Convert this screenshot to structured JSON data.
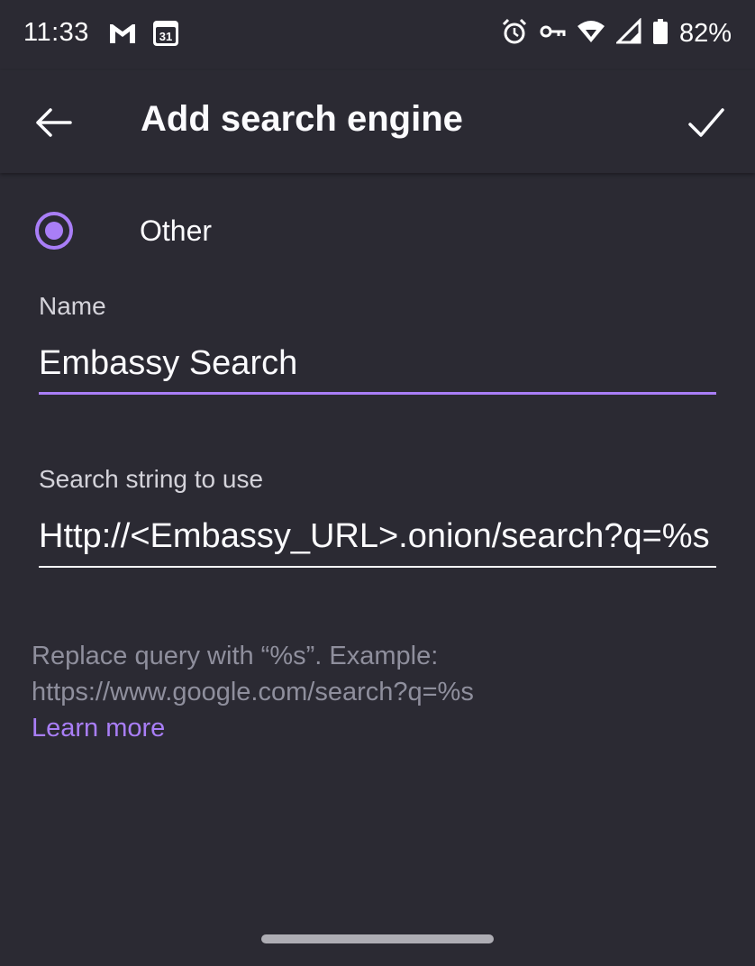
{
  "status_bar": {
    "time": "11:33",
    "battery_percent": "82%",
    "calendar_day": "31",
    "icons": [
      "gmail-icon",
      "calendar-icon",
      "alarm-icon",
      "vpn-key-icon",
      "wifi-icon",
      "cell-signal-icon",
      "battery-icon"
    ]
  },
  "app_bar": {
    "title": "Add search engine",
    "back_icon": "arrow-left-icon",
    "save_icon": "checkmark-icon"
  },
  "engine_option": {
    "label": "Other",
    "selected": true
  },
  "name_field": {
    "label": "Name",
    "value": "Embassy Search"
  },
  "search_string_field": {
    "label": "Search string to use",
    "value": "Http://<Embassy_URL>.onion/search?q=%s"
  },
  "helper": {
    "line1": "Replace query with “%s”. Example:",
    "line2": "https://www.google.com/search?q=%s",
    "learn_more": "Learn more"
  },
  "colors": {
    "background": "#2b2a33",
    "accent": "#a97ef7",
    "text_primary": "#fbfbfe",
    "text_secondary": "#8f8f9d"
  }
}
